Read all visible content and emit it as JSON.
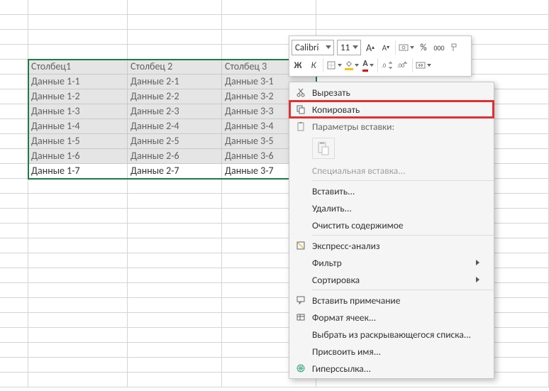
{
  "table": {
    "headers": [
      "Столбец1",
      "Столбец 2",
      "Столбец 3"
    ],
    "rows": [
      [
        "Данные 1-1",
        "Данные 2-1",
        "Данные 3-1"
      ],
      [
        "Данные 1-2",
        "Данные 2-2",
        "Данные 3-2"
      ],
      [
        "Данные 1-3",
        "Данные 2-3",
        "Данные 3-3"
      ],
      [
        "Данные 1-4",
        "Данные 2-4",
        "Данные 3-4"
      ],
      [
        "Данные 1-5",
        "Данные 2-5",
        "Данные 3-5"
      ],
      [
        "Данные 1-6",
        "Данные 2-6",
        "Данные 3-6"
      ],
      [
        "Данные 1-7",
        "Данные 2-7",
        "Данные 3-7"
      ]
    ]
  },
  "toolbar": {
    "font_name": "Calibri",
    "font_size": "11",
    "increase_font": "A",
    "decrease_font": "A",
    "percent": "%",
    "thousands": "000",
    "bold": "Ж",
    "italic": "К"
  },
  "context_menu": {
    "cut": "Вырезать",
    "copy": "Копировать",
    "paste_options": "Параметры вставки:",
    "paste_special": "Специальная вставка...",
    "insert": "Вставить...",
    "delete": "Удалить...",
    "clear": "Очистить содержимое",
    "quick_analysis": "Экспресс-анализ",
    "filter": "Фильтр",
    "sort": "Сортировка",
    "insert_comment": "Вставить примечание",
    "format_cells": "Формат ячеек...",
    "pick_from_list": "Выбрать из раскрывающегося списка...",
    "define_name": "Присвоить имя...",
    "hyperlink": "Гиперссылка..."
  }
}
